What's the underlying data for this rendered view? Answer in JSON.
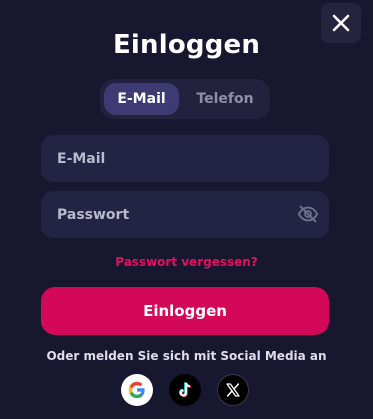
{
  "dialog": {
    "title": "Einloggen",
    "close_icon": "close-icon"
  },
  "tabs": [
    {
      "label": "E-Mail",
      "active": true
    },
    {
      "label": "Telefon",
      "active": false
    }
  ],
  "fields": {
    "email": {
      "placeholder": "E-Mail",
      "value": ""
    },
    "password": {
      "placeholder": "Passwort",
      "value": "",
      "toggle_icon": "eye-off-icon"
    }
  },
  "forgot_link": "Passwort vergessen?",
  "submit_label": "Einloggen",
  "social": {
    "prompt": "Oder melden Sie sich mit Social Media an",
    "providers": [
      {
        "name": "Google",
        "icon": "google-icon"
      },
      {
        "name": "TikTok",
        "icon": "tiktok-icon"
      },
      {
        "name": "X",
        "icon": "x-icon"
      }
    ]
  },
  "colors": {
    "background": "#17172f",
    "field": "#232343",
    "tab_active": "#3d3a74",
    "accent": "#d40858",
    "link": "#e0125e"
  }
}
